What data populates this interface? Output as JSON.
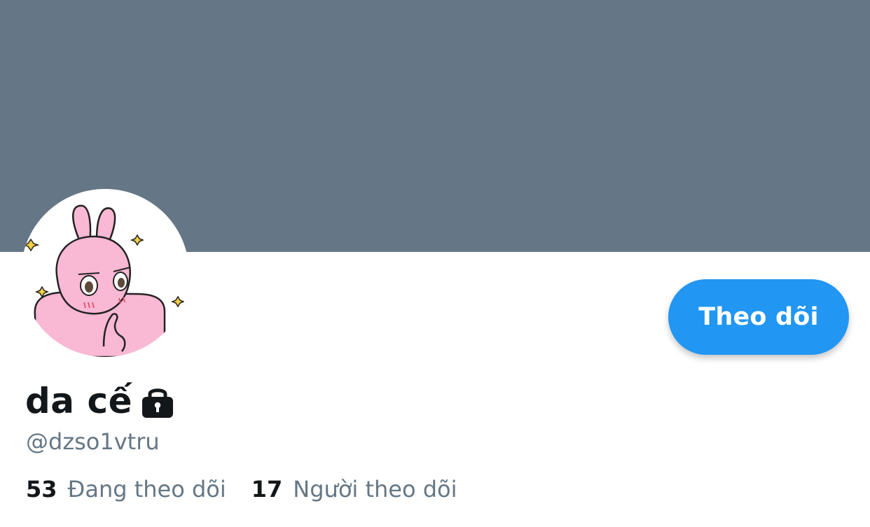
{
  "profile": {
    "display_name": "da cế",
    "handle": "@dzso1vtru",
    "avatar_icon": "pink-rabbit-avatar",
    "lock_icon": "lock-icon"
  },
  "actions": {
    "follow_label": "Theo dõi"
  },
  "stats": {
    "following_count": "53",
    "following_label": "Đang theo dõi",
    "followers_count": "17",
    "followers_label": "Người theo dõi"
  },
  "colors": {
    "banner": "#657786",
    "accent": "#2196f3",
    "primary_text": "#14171a",
    "secondary_text": "#657786"
  }
}
